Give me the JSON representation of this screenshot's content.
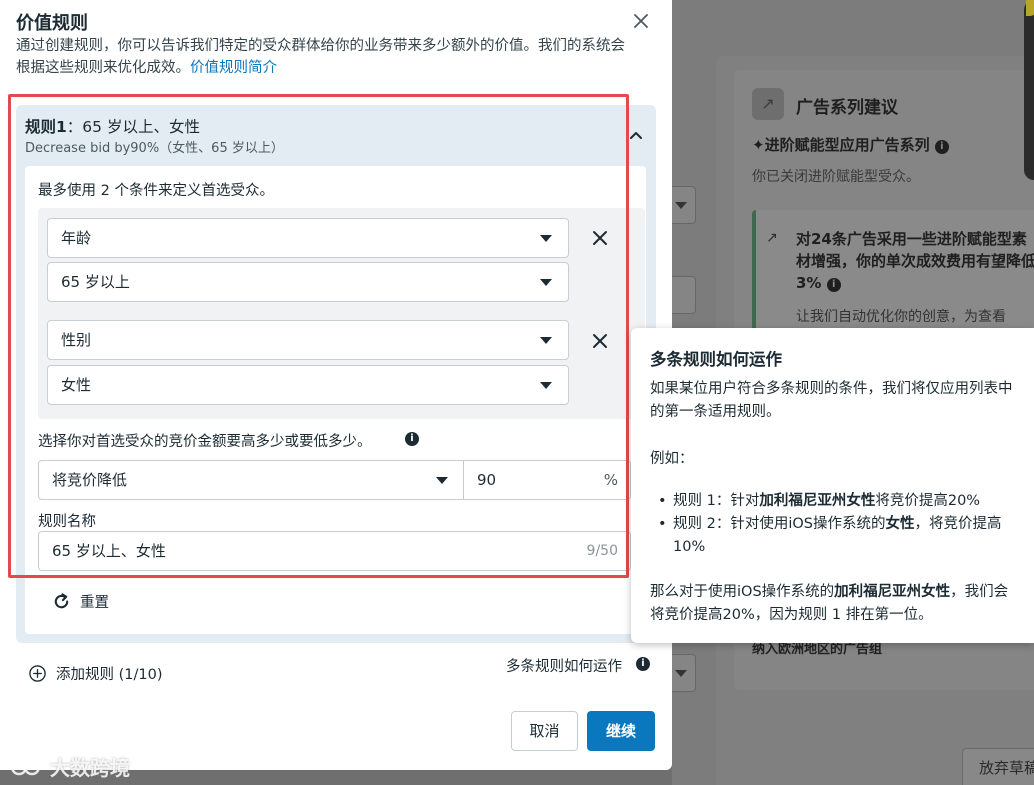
{
  "modal": {
    "title": "价值规则",
    "description": "通过创建规则，你可以告诉我们特定的受众群体给你的业务带来多少额外的价值。我们的系统会根据这些规则来优化成效。",
    "description_link": "价值规则简介"
  },
  "rule": {
    "title_prefix": "规则1",
    "title_suffix": "：65 岁以上、女性",
    "subtitle": "Decrease bid by90%（女性、65 岁以上）",
    "condition_hint": "最多使用 2 个条件来定义首选受众。",
    "conditions": [
      {
        "type": "年龄",
        "value": "65 岁以上"
      },
      {
        "type": "性别",
        "value": "女性"
      }
    ],
    "bid_hint": "选择你对首选受众的竞价金额要高多少或要低多少。",
    "bid_action": "将竞价降低",
    "bid_value": "90",
    "bid_unit": "%",
    "name_label": "规则名称",
    "name_value": "65 岁以上、女性",
    "name_count": "9/50",
    "reset_label": "重置"
  },
  "footer": {
    "add_rule": "添加规则 (1/10)",
    "multi_rules_link": "多条规则如何运作",
    "cancel": "取消",
    "continue": "继续"
  },
  "tooltip": {
    "title": "多条规则如何运作",
    "body": "如果某位用户符合多条规则的条件，我们将仅应用列表中的第一条适用规则。",
    "example_label": "例如：",
    "item1_prefix": "规则 1：针对",
    "item1_bold": "加利福尼亚州女性",
    "item1_suffix": "将竞价提高20%",
    "item2_prefix": "规则 2：针对使用iOS操作系统的",
    "item2_bold": "女性",
    "item2_suffix": "，将竞价提高10%",
    "conclusion_prefix": "那么对于使用iOS操作系统的",
    "conclusion_bold": "加利福尼亚州女性",
    "conclusion_suffix": "，我们会将竞价提高20%，因为规则 1 排在第一位。"
  },
  "background": {
    "panel_title": "广告系列建议",
    "subtitle": "✦进阶赋能型应用广告系列",
    "note": "你已关闭进阶赋能型受众。",
    "suggestion_title": "对24条广告采用一些进阶赋能型素材增强，你的单次成效费用有望降低3%",
    "suggestion_note": "让我们自动优化你的创意，为查看",
    "eu_text": "纳入欧洲地区的广告组",
    "abandon_button": "放弃草稿"
  },
  "watermark": "大数跨境",
  "colors": {
    "primary": "#0a78be",
    "highlight": "#e5484d",
    "card_bg": "#e4ecf3"
  },
  "icons": {
    "close": "close-icon",
    "collapse": "chevron-up-icon",
    "remove": "x-icon",
    "dropdown": "caret-down-icon",
    "info": "info-icon",
    "reset": "refresh-icon",
    "add": "plus-circle-icon"
  }
}
